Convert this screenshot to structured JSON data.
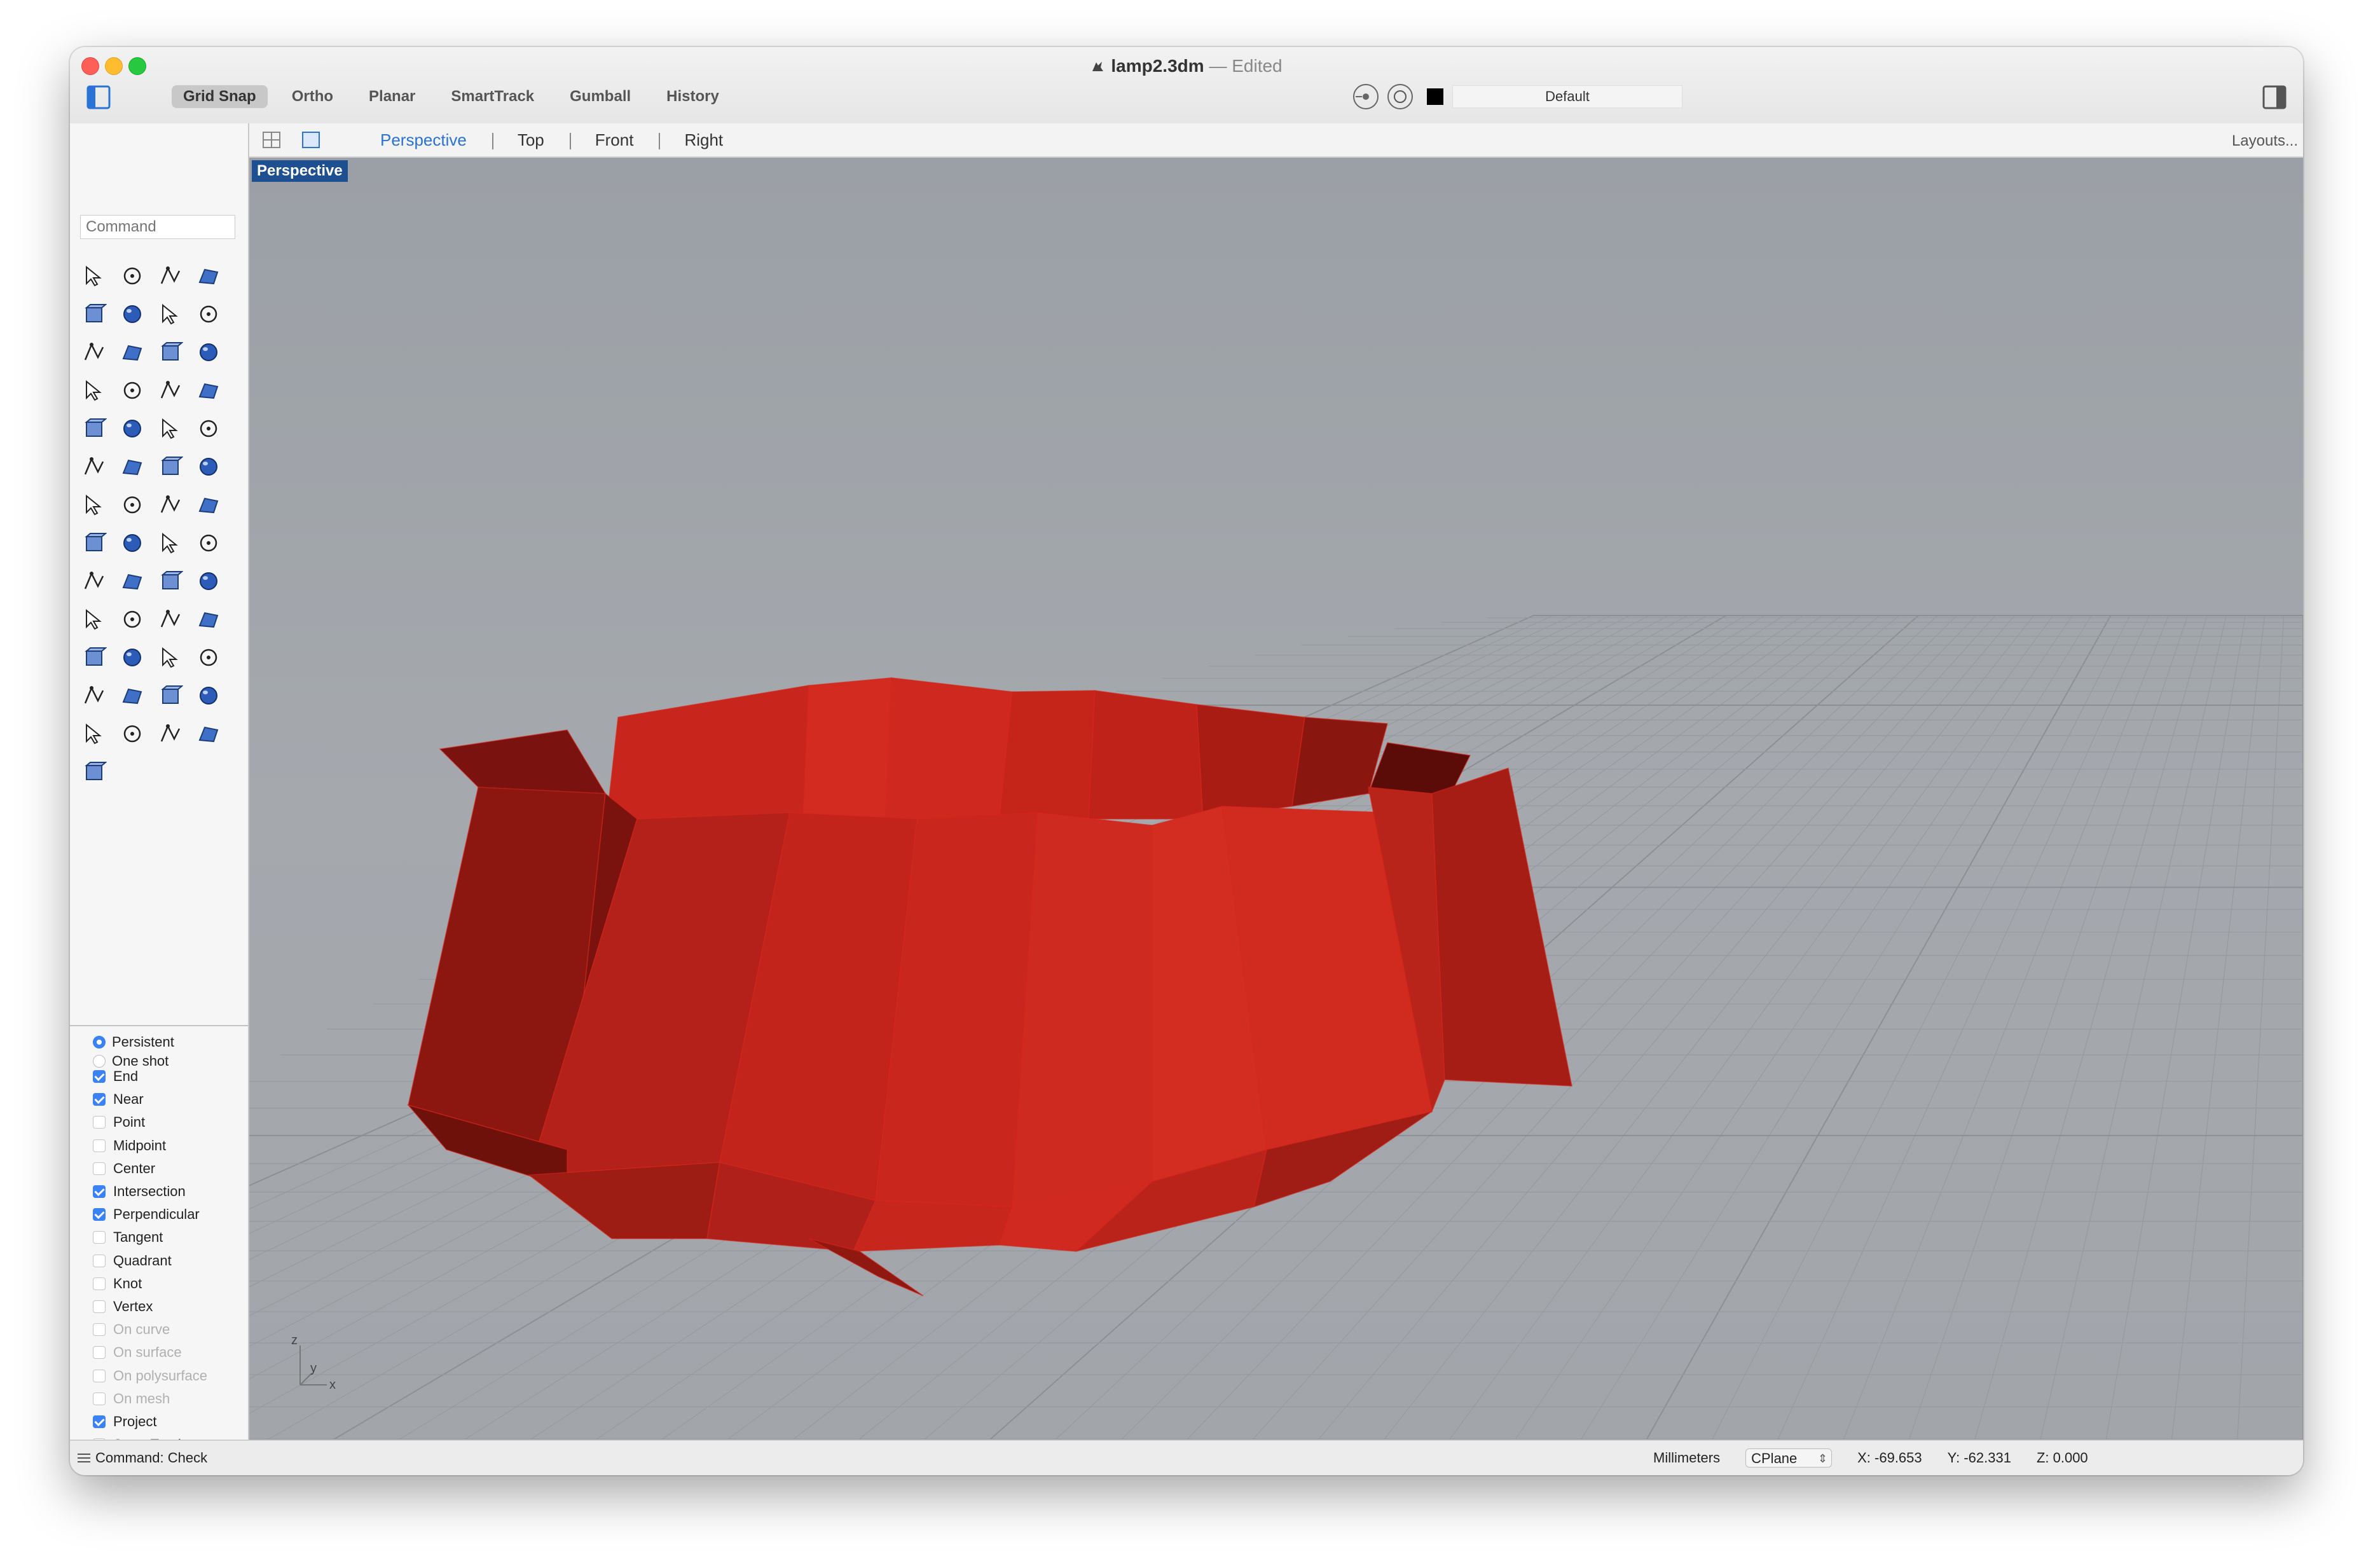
{
  "window": {
    "file_name": "lamp2.3dm",
    "separator": "—",
    "edited_label": "Edited"
  },
  "toolbar": {
    "modes": [
      {
        "label": "Grid Snap",
        "active": true
      },
      {
        "label": "Ortho",
        "active": false
      },
      {
        "label": "Planar",
        "active": false
      },
      {
        "label": "SmartTrack",
        "active": false
      },
      {
        "label": "Gumball",
        "active": false
      },
      {
        "label": "History",
        "active": false
      }
    ],
    "layer_name": "Default",
    "layer_color": "#000000"
  },
  "viewport_tabs": {
    "tabs": [
      "Perspective",
      "Top",
      "Front",
      "Right"
    ],
    "active": "Perspective",
    "layouts_label": "Layouts..."
  },
  "viewport": {
    "label": "Perspective",
    "object_color": "#d9241b",
    "axes": {
      "z": "z",
      "y": "y",
      "x": "x"
    }
  },
  "command": {
    "placeholder": "Command"
  },
  "osnap": {
    "modes": [
      {
        "label": "Persistent",
        "selected": true
      },
      {
        "label": "One shot",
        "selected": false
      }
    ],
    "options": [
      {
        "label": "End",
        "checked": true,
        "enabled": true
      },
      {
        "label": "Near",
        "checked": true,
        "enabled": true
      },
      {
        "label": "Point",
        "checked": false,
        "enabled": true
      },
      {
        "label": "Midpoint",
        "checked": false,
        "enabled": true
      },
      {
        "label": "Center",
        "checked": false,
        "enabled": true
      },
      {
        "label": "Intersection",
        "checked": true,
        "enabled": true
      },
      {
        "label": "Perpendicular",
        "checked": true,
        "enabled": true
      },
      {
        "label": "Tangent",
        "checked": false,
        "enabled": true
      },
      {
        "label": "Quadrant",
        "checked": false,
        "enabled": true
      },
      {
        "label": "Knot",
        "checked": false,
        "enabled": true
      },
      {
        "label": "Vertex",
        "checked": false,
        "enabled": true
      },
      {
        "label": "On curve",
        "checked": false,
        "enabled": false
      },
      {
        "label": "On surface",
        "checked": false,
        "enabled": false
      },
      {
        "label": "On polysurface",
        "checked": false,
        "enabled": false
      },
      {
        "label": "On mesh",
        "checked": false,
        "enabled": false
      },
      {
        "label": "Project",
        "checked": true,
        "enabled": true
      },
      {
        "label": "SmartTrack",
        "checked": false,
        "enabled": true
      }
    ]
  },
  "status": {
    "command": "Command: Check",
    "units": "Millimeters",
    "cplane": "CPlane",
    "x": "X: -69.653",
    "y": "Y: -62.331",
    "z": "Z: 0.000"
  }
}
